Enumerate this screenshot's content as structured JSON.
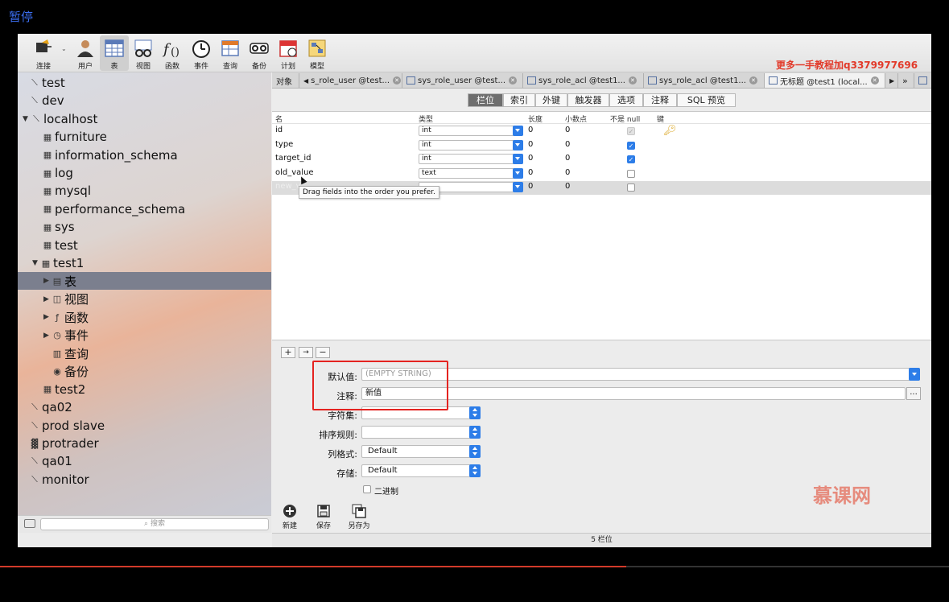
{
  "overlay": {
    "pause_label": "暂停",
    "watermark_top": "更多一手教程加q3379977696",
    "logo_watermark": "慕课网",
    "progress_fraction": 0.66
  },
  "toolbar": {
    "items": [
      {
        "name": "connect",
        "label": "连接",
        "icon": "connection-icon"
      },
      {
        "name": "user",
        "label": "用户",
        "icon": "user-icon"
      },
      {
        "name": "table",
        "label": "表",
        "icon": "table-icon",
        "active": true
      },
      {
        "name": "view",
        "label": "视图",
        "icon": "view-icon"
      },
      {
        "name": "function",
        "label": "函数",
        "icon": "function-icon"
      },
      {
        "name": "event",
        "label": "事件",
        "icon": "clock-icon"
      },
      {
        "name": "query",
        "label": "查询",
        "icon": "query-icon"
      },
      {
        "name": "backup",
        "label": "备份",
        "icon": "backup-icon"
      },
      {
        "name": "schedule",
        "label": "计划",
        "icon": "calendar-icon"
      },
      {
        "name": "model",
        "label": "模型",
        "icon": "model-icon"
      }
    ]
  },
  "sidebar": {
    "items": [
      {
        "label": "test",
        "icon": "connection-icon",
        "indent": 0
      },
      {
        "label": "dev",
        "icon": "connection-icon",
        "indent": 0
      },
      {
        "label": "localhost",
        "icon": "connection-icon",
        "indent": 0,
        "expanded": true
      },
      {
        "label": "furniture",
        "icon": "database-icon",
        "indent": 1
      },
      {
        "label": "information_schema",
        "icon": "database-icon",
        "indent": 1
      },
      {
        "label": "log",
        "icon": "database-icon",
        "indent": 1
      },
      {
        "label": "mysql",
        "icon": "database-icon",
        "indent": 1
      },
      {
        "label": "performance_schema",
        "icon": "database-icon",
        "indent": 1
      },
      {
        "label": "sys",
        "icon": "database-icon",
        "indent": 1
      },
      {
        "label": "test",
        "icon": "database-icon",
        "indent": 1
      },
      {
        "label": "test1",
        "icon": "database-icon",
        "indent": 1,
        "expanded": true
      },
      {
        "label": "表",
        "icon": "table-icon",
        "indent": 2,
        "selected": true,
        "collapsible": true
      },
      {
        "label": "视图",
        "icon": "view-icon",
        "indent": 2,
        "collapsible": true
      },
      {
        "label": "函数",
        "icon": "function-icon",
        "indent": 2,
        "collapsible": true
      },
      {
        "label": "事件",
        "icon": "clock-icon",
        "indent": 2,
        "collapsible": true
      },
      {
        "label": "查询",
        "icon": "query-icon",
        "indent": 2
      },
      {
        "label": "备份",
        "icon": "backup-icon",
        "indent": 2
      },
      {
        "label": "test2",
        "icon": "database-icon",
        "indent": 1
      },
      {
        "label": "qa02",
        "icon": "connection-icon",
        "indent": 0
      },
      {
        "label": "prod slave",
        "icon": "connection-icon",
        "indent": 0
      },
      {
        "label": "protrader",
        "icon": "server-icon",
        "indent": 0
      },
      {
        "label": "qa01",
        "icon": "connection-icon",
        "indent": 0
      },
      {
        "label": "monitor",
        "icon": "connection-icon",
        "indent": 0
      }
    ],
    "search_placeholder": "搜索"
  },
  "tabs": [
    {
      "label": "对象",
      "closable": false
    },
    {
      "label": "s_role_user @test...",
      "closable": true
    },
    {
      "label": "sys_role_user @test...",
      "closable": true
    },
    {
      "label": "sys_role_acl @test1...",
      "closable": true
    },
    {
      "label": "sys_role_acl @test1...",
      "closable": true
    },
    {
      "label": "无标题 @test1 (local...",
      "closable": true,
      "active": true
    }
  ],
  "segments": [
    {
      "label": "栏位",
      "active": true
    },
    {
      "label": "索引"
    },
    {
      "label": "外键"
    },
    {
      "label": "触发器"
    },
    {
      "label": "选项"
    },
    {
      "label": "注释"
    },
    {
      "label": "SQL 预览"
    }
  ],
  "grid": {
    "headers": [
      "名",
      "类型",
      "长度",
      "小数点",
      "不是 null",
      "键"
    ],
    "rows": [
      {
        "name": "id",
        "type": "int",
        "length": "0",
        "decimals": "0",
        "not_null": "dim",
        "key": true
      },
      {
        "name": "type",
        "type": "int",
        "length": "0",
        "decimals": "0",
        "not_null": "on",
        "key": false
      },
      {
        "name": "target_id",
        "type": "int",
        "length": "0",
        "decimals": "0",
        "not_null": "on",
        "key": false
      },
      {
        "name": "old_value",
        "type": "text",
        "length": "0",
        "decimals": "0",
        "not_null": "off",
        "key": false
      },
      {
        "name": "new_v",
        "type": "",
        "length": "0",
        "decimals": "0",
        "not_null": "off",
        "key": false
      }
    ],
    "tooltip": "Drag fields into the order you prefer."
  },
  "row_buttons": {
    "add": "+",
    "insert": "→",
    "remove": "−"
  },
  "props": {
    "default_label": "默认值:",
    "default_placeholder": "(EMPTY STRING)",
    "comment_label": "注释:",
    "comment_value": "新值",
    "comment_more": "...",
    "charset_label": "字符集:",
    "collation_label": "排序规则:",
    "format_label": "列格式:",
    "format_value": "Default",
    "storage_label": "存储:",
    "storage_value": "Default",
    "binary_label": "二进制"
  },
  "actions": [
    {
      "label": "新建",
      "icon": "add-circle-icon"
    },
    {
      "label": "保存",
      "icon": "save-icon"
    },
    {
      "label": "另存为",
      "icon": "save-as-icon"
    }
  ],
  "status": "5 栏位"
}
